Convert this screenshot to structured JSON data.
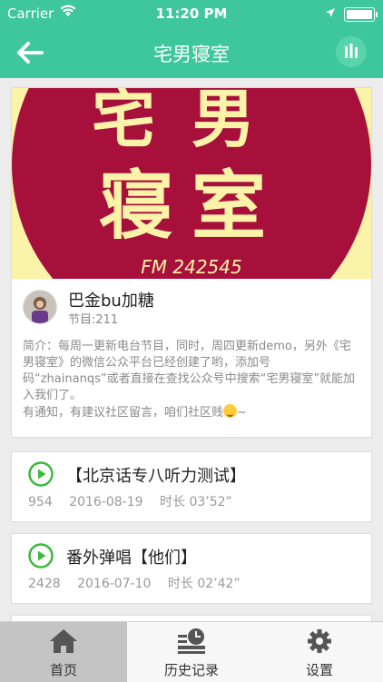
{
  "status_bar": {
    "carrier": "Carrier",
    "time": "11:20 PM"
  },
  "nav": {
    "title": "宅男寝室"
  },
  "cover": {
    "line1": "宅男",
    "line2": "寝室",
    "fm": "FM 242545"
  },
  "host": {
    "name": "巴金bu加糖",
    "episode_count": "节目:211"
  },
  "intro": {
    "text": "简介：每周一更新电台节目，同时，周四更新demo，另外《宅男寝室》的微信公众平台已经创建了哟，添加号码“zhainanqs”或者直接在查找公众号中搜索“宅男寝室”就能加入我们了。",
    "text2": "有通知，有建议社区留言，咱们社区贱",
    "tail": "~"
  },
  "episodes": [
    {
      "title": "【北京话专八听力测试】",
      "plays": "954",
      "date": "2016-08-19",
      "duration": "时长 03’52”"
    },
    {
      "title": "番外弹唱【他们】",
      "plays": "2428",
      "date": "2016-07-10",
      "duration": "时长 02’42”"
    }
  ],
  "tabs": [
    {
      "label": "首页",
      "icon": "home-icon"
    },
    {
      "label": "历史记录",
      "icon": "history-icon"
    },
    {
      "label": "设置",
      "icon": "settings-icon"
    }
  ],
  "colors": {
    "accent": "#3ec79a",
    "cover_red": "#a8103c",
    "cover_yellow": "#fbf3a8",
    "play_green": "#3db83d"
  }
}
